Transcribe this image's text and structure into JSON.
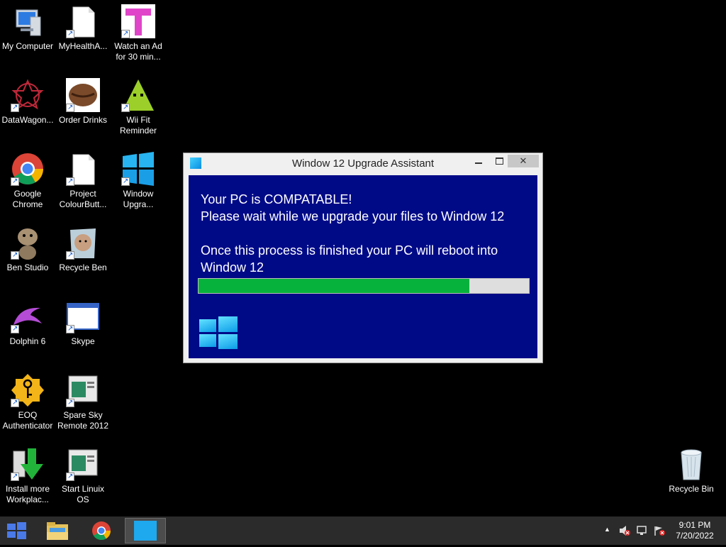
{
  "desktop": {
    "icons": [
      {
        "label": "My Computer"
      },
      {
        "label": "MyHealthA..."
      },
      {
        "label": "Watch an Ad\nfor 30 min..."
      },
      {
        "label": "DataWagon..."
      },
      {
        "label": "Order Drinks"
      },
      {
        "label": "Wii Fit\nReminder"
      },
      {
        "label": "Google\nChrome"
      },
      {
        "label": "Project\nColourButt..."
      },
      {
        "label": "Window\nUpgra..."
      },
      {
        "label": "Ben Studio"
      },
      {
        "label": "Recycle Ben"
      },
      {
        "label": "Dolphin 6"
      },
      {
        "label": "Skype"
      },
      {
        "label": "EOQ\nAuthenticator"
      },
      {
        "label": "Spare Sky\nRemote 2012"
      },
      {
        "label": "Install more\nWorkplac..."
      },
      {
        "label": "Start Linuix\nOS"
      },
      {
        "label": "Recycle Bin"
      }
    ]
  },
  "window": {
    "title": "Window 12 Upgrade Assistant",
    "close_glyph": "✕",
    "line1": "Your PC is COMPATABLE!",
    "line2": "Please wait while we upgrade your files to Window 12",
    "line3": "Once this process is finished your PC will reboot into",
    "line4": "Window 12",
    "progress_fraction": 0.82,
    "bg_color": "#000a87",
    "progress_color": "#07b23c"
  },
  "taskbar": {
    "time": "9:01 PM",
    "date": "7/20/2022",
    "tray_arrow": "▲"
  }
}
